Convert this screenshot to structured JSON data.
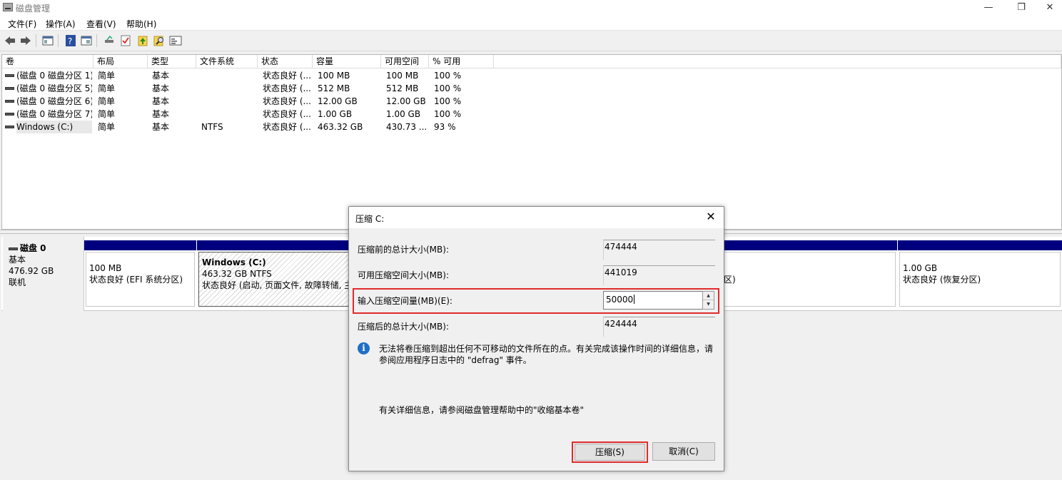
{
  "window": {
    "title": "磁盘管理",
    "minimize": "—",
    "restore": "❐",
    "close": "✕"
  },
  "menu": [
    {
      "label": "文件(F)"
    },
    {
      "label": "操作(A)"
    },
    {
      "label": "查看(V)"
    },
    {
      "label": "帮助(H)"
    }
  ],
  "toolbar": {
    "icons": [
      "back-arrow-icon",
      "forward-arrow-icon",
      "properties-icon",
      "help-icon",
      "console-tree-icon",
      "disk-connect-icon",
      "check-icon",
      "upgrade-icon",
      "search-disk-icon",
      "console-window-icon"
    ]
  },
  "volume_table": {
    "columns": [
      "卷",
      "布局",
      "类型",
      "文件系统",
      "状态",
      "容量",
      "可用空间",
      "% 可用"
    ],
    "rows": [
      {
        "volume": "(磁盘 0 磁盘分区 1)",
        "layout": "简单",
        "type": "基本",
        "fs": "",
        "status": "状态良好 (...",
        "capacity": "100 MB",
        "free": "100 MB",
        "pct": "100 %"
      },
      {
        "volume": "(磁盘 0 磁盘分区 5)",
        "layout": "简单",
        "type": "基本",
        "fs": "",
        "status": "状态良好 (...",
        "capacity": "512 MB",
        "free": "512 MB",
        "pct": "100 %"
      },
      {
        "volume": "(磁盘 0 磁盘分区 6)",
        "layout": "简单",
        "type": "基本",
        "fs": "",
        "status": "状态良好 (...",
        "capacity": "12.00 GB",
        "free": "12.00 GB",
        "pct": "100 %"
      },
      {
        "volume": "(磁盘 0 磁盘分区 7)",
        "layout": "简单",
        "type": "基本",
        "fs": "",
        "status": "状态良好 (...",
        "capacity": "1.00 GB",
        "free": "1.00 GB",
        "pct": "100 %"
      },
      {
        "volume": "Windows (C:)",
        "layout": "简单",
        "type": "基本",
        "fs": "NTFS",
        "status": "状态良好 (...",
        "capacity": "463.32 GB",
        "free": "430.73 ...",
        "pct": "93 %"
      }
    ]
  },
  "disk0": {
    "name": "磁盘 0",
    "type": "基本",
    "size": "476.92 GB",
    "state": "联机",
    "partitions": [
      {
        "title": "",
        "size": "100 MB",
        "status": "状态良好 (EFI 系统分区)"
      },
      {
        "title": "Windows  (C:)",
        "size": "463.32 GB NTFS",
        "status": "状态良好 (启动, 页面文件, 故障转储, 主"
      },
      {
        "title": "",
        "size": "",
        "status": "区)"
      },
      {
        "title": "",
        "size": "1.00 GB",
        "status": "状态良好 (恢复分区)"
      }
    ]
  },
  "dialog": {
    "title": "压缩 C:",
    "close": "✕",
    "total_before_label": "压缩前的总计大小(MB):",
    "total_before_value": "474444",
    "available_label": "可用压缩空间大小(MB):",
    "available_value": "441019",
    "input_label": "输入压缩空间量(MB)(E):",
    "input_value": "50000",
    "total_after_label": "压缩后的总计大小(MB):",
    "total_after_value": "424444",
    "info_line1": "无法将卷压缩到超出任何不可移动的文件所在的点。有关完成该操作时间的详细信息，请",
    "info_line2": "参阅应用程序日志中的 \"defrag\" 事件。",
    "detail_text": "有关详细信息，请参阅磁盘管理帮助中的\"收缩基本卷\"",
    "shrink_button": "压缩(S)",
    "cancel_button": "取消(C)",
    "spin_up": "▲",
    "spin_down": "▼"
  },
  "colors": {
    "partition_bar": "#00007f",
    "highlight": "#e02b2b",
    "info_icon": "#1f6fc5"
  }
}
